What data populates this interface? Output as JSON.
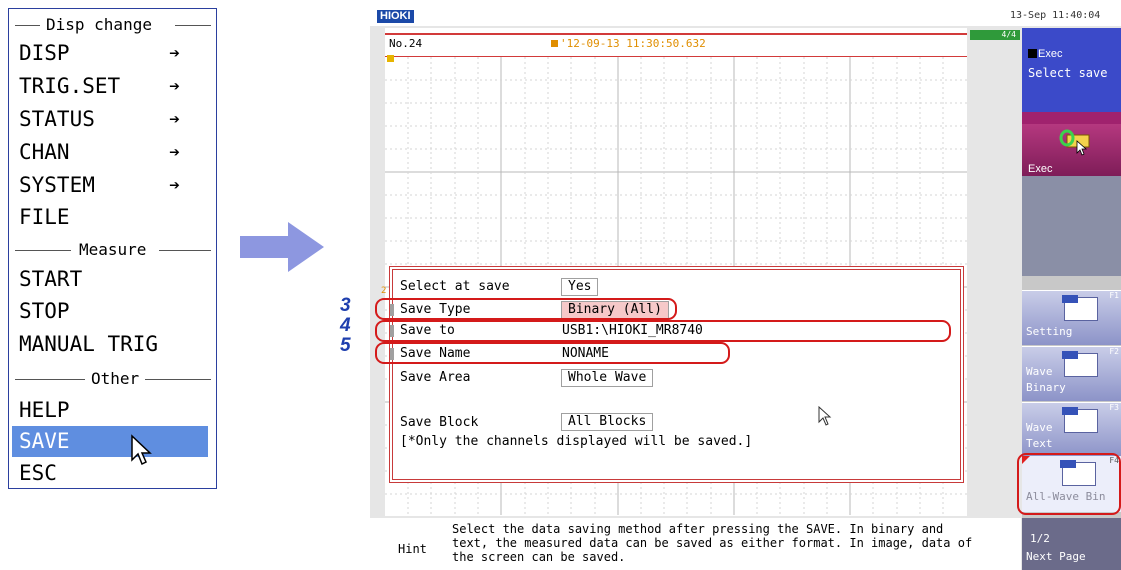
{
  "menu": {
    "sections": {
      "disp_change": "Disp change",
      "measure": "Measure",
      "other": "Other"
    },
    "items": [
      {
        "label": "DISP",
        "arrow": "➔"
      },
      {
        "label": "TRIG.SET",
        "arrow": "➔"
      },
      {
        "label": "STATUS",
        "arrow": "➔"
      },
      {
        "label": "CHAN",
        "arrow": "➔"
      },
      {
        "label": "SYSTEM",
        "arrow": "➔"
      },
      {
        "label": "FILE",
        "arrow": ""
      },
      {
        "label": "START",
        "arrow": ""
      },
      {
        "label": "STOP",
        "arrow": ""
      },
      {
        "label": "MANUAL TRIG",
        "arrow": ""
      },
      {
        "label": "HELP",
        "arrow": ""
      },
      {
        "label": "SAVE",
        "arrow": ""
      },
      {
        "label": "ESC",
        "arrow": ""
      }
    ],
    "selected": "SAVE",
    "selected_color": "#5f8ee0"
  },
  "screen": {
    "logo": "HIOKI",
    "clock": "13-Sep 11:40:04",
    "page_indicator": "4/4",
    "record_no": "No.24",
    "trigger_time": "'12-09-13 11:30:50.632"
  },
  "dialog": {
    "rows": [
      {
        "label": "Select at save",
        "value": "Yes"
      },
      {
        "label": "Save Type",
        "value": "Binary (All)"
      },
      {
        "label": "Save to",
        "value": "USB1:\\HIOKI_MR8740"
      },
      {
        "label": "Save Name",
        "value": "NONAME"
      },
      {
        "label": "Save Area",
        "value": "Whole Wave"
      },
      {
        "label": "Save Block",
        "value": "All Blocks"
      }
    ],
    "note": "[*Only the channels displayed will be saved.]",
    "marker": "2"
  },
  "callouts": [
    "3",
    "4",
    "5"
  ],
  "hint": {
    "label": "Hint",
    "text": "Select the data saving method after pressing the SAVE. In binary and\ntext, the measured data can be saved as either format. In image, data of\nthe screen can be saved."
  },
  "right_panel": {
    "exec_title": "Exec",
    "exec_subtitle": "Select save",
    "exec_button": "Exec",
    "fkeys": [
      {
        "key": "F1",
        "line1": "Setting",
        "line2": ""
      },
      {
        "key": "F2",
        "line1": "Wave",
        "line2": "Binary"
      },
      {
        "key": "F3",
        "line1": "Wave",
        "line2": "Text"
      },
      {
        "key": "F4",
        "line1": "All-Wave Bin",
        "line2": ""
      }
    ],
    "f5": {
      "line1": "1/2",
      "line2": "Next Page"
    }
  },
  "colors": {
    "accent_blue": "#3b4ac9",
    "highlight_red": "#d41a1a",
    "callout_blue": "#1f3fae",
    "exec_magenta": "#a0226e"
  },
  "icons": [
    "right-arrow-icon",
    "cursor-icon",
    "exec-save-icon",
    "setting-file-icon",
    "binary-wave-icon",
    "text-wave-icon",
    "all-wave-binary-icon"
  ]
}
